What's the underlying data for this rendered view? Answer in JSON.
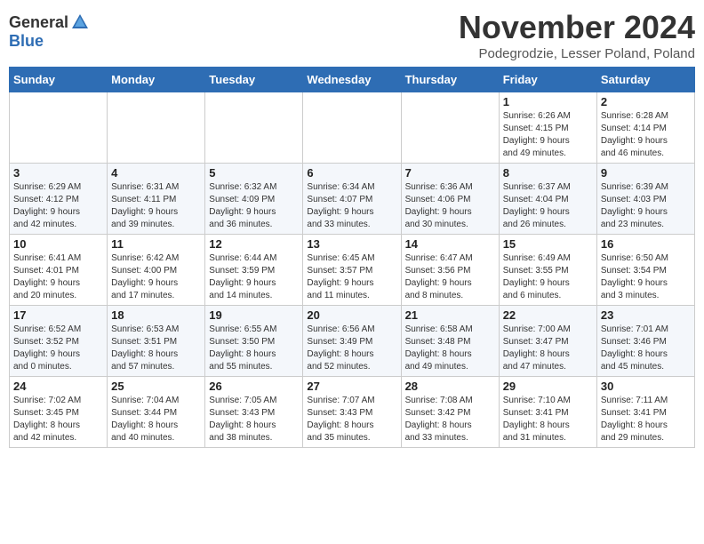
{
  "header": {
    "logo_general": "General",
    "logo_blue": "Blue",
    "month_title": "November 2024",
    "location": "Podegrodzie, Lesser Poland, Poland"
  },
  "days_of_week": [
    "Sunday",
    "Monday",
    "Tuesday",
    "Wednesday",
    "Thursday",
    "Friday",
    "Saturday"
  ],
  "weeks": [
    {
      "days": [
        {
          "num": "",
          "info": ""
        },
        {
          "num": "",
          "info": ""
        },
        {
          "num": "",
          "info": ""
        },
        {
          "num": "",
          "info": ""
        },
        {
          "num": "",
          "info": ""
        },
        {
          "num": "1",
          "info": "Sunrise: 6:26 AM\nSunset: 4:15 PM\nDaylight: 9 hours\nand 49 minutes."
        },
        {
          "num": "2",
          "info": "Sunrise: 6:28 AM\nSunset: 4:14 PM\nDaylight: 9 hours\nand 46 minutes."
        }
      ]
    },
    {
      "days": [
        {
          "num": "3",
          "info": "Sunrise: 6:29 AM\nSunset: 4:12 PM\nDaylight: 9 hours\nand 42 minutes."
        },
        {
          "num": "4",
          "info": "Sunrise: 6:31 AM\nSunset: 4:11 PM\nDaylight: 9 hours\nand 39 minutes."
        },
        {
          "num": "5",
          "info": "Sunrise: 6:32 AM\nSunset: 4:09 PM\nDaylight: 9 hours\nand 36 minutes."
        },
        {
          "num": "6",
          "info": "Sunrise: 6:34 AM\nSunset: 4:07 PM\nDaylight: 9 hours\nand 33 minutes."
        },
        {
          "num": "7",
          "info": "Sunrise: 6:36 AM\nSunset: 4:06 PM\nDaylight: 9 hours\nand 30 minutes."
        },
        {
          "num": "8",
          "info": "Sunrise: 6:37 AM\nSunset: 4:04 PM\nDaylight: 9 hours\nand 26 minutes."
        },
        {
          "num": "9",
          "info": "Sunrise: 6:39 AM\nSunset: 4:03 PM\nDaylight: 9 hours\nand 23 minutes."
        }
      ]
    },
    {
      "days": [
        {
          "num": "10",
          "info": "Sunrise: 6:41 AM\nSunset: 4:01 PM\nDaylight: 9 hours\nand 20 minutes."
        },
        {
          "num": "11",
          "info": "Sunrise: 6:42 AM\nSunset: 4:00 PM\nDaylight: 9 hours\nand 17 minutes."
        },
        {
          "num": "12",
          "info": "Sunrise: 6:44 AM\nSunset: 3:59 PM\nDaylight: 9 hours\nand 14 minutes."
        },
        {
          "num": "13",
          "info": "Sunrise: 6:45 AM\nSunset: 3:57 PM\nDaylight: 9 hours\nand 11 minutes."
        },
        {
          "num": "14",
          "info": "Sunrise: 6:47 AM\nSunset: 3:56 PM\nDaylight: 9 hours\nand 8 minutes."
        },
        {
          "num": "15",
          "info": "Sunrise: 6:49 AM\nSunset: 3:55 PM\nDaylight: 9 hours\nand 6 minutes."
        },
        {
          "num": "16",
          "info": "Sunrise: 6:50 AM\nSunset: 3:54 PM\nDaylight: 9 hours\nand 3 minutes."
        }
      ]
    },
    {
      "days": [
        {
          "num": "17",
          "info": "Sunrise: 6:52 AM\nSunset: 3:52 PM\nDaylight: 9 hours\nand 0 minutes."
        },
        {
          "num": "18",
          "info": "Sunrise: 6:53 AM\nSunset: 3:51 PM\nDaylight: 8 hours\nand 57 minutes."
        },
        {
          "num": "19",
          "info": "Sunrise: 6:55 AM\nSunset: 3:50 PM\nDaylight: 8 hours\nand 55 minutes."
        },
        {
          "num": "20",
          "info": "Sunrise: 6:56 AM\nSunset: 3:49 PM\nDaylight: 8 hours\nand 52 minutes."
        },
        {
          "num": "21",
          "info": "Sunrise: 6:58 AM\nSunset: 3:48 PM\nDaylight: 8 hours\nand 49 minutes."
        },
        {
          "num": "22",
          "info": "Sunrise: 7:00 AM\nSunset: 3:47 PM\nDaylight: 8 hours\nand 47 minutes."
        },
        {
          "num": "23",
          "info": "Sunrise: 7:01 AM\nSunset: 3:46 PM\nDaylight: 8 hours\nand 45 minutes."
        }
      ]
    },
    {
      "days": [
        {
          "num": "24",
          "info": "Sunrise: 7:02 AM\nSunset: 3:45 PM\nDaylight: 8 hours\nand 42 minutes."
        },
        {
          "num": "25",
          "info": "Sunrise: 7:04 AM\nSunset: 3:44 PM\nDaylight: 8 hours\nand 40 minutes."
        },
        {
          "num": "26",
          "info": "Sunrise: 7:05 AM\nSunset: 3:43 PM\nDaylight: 8 hours\nand 38 minutes."
        },
        {
          "num": "27",
          "info": "Sunrise: 7:07 AM\nSunset: 3:43 PM\nDaylight: 8 hours\nand 35 minutes."
        },
        {
          "num": "28",
          "info": "Sunrise: 7:08 AM\nSunset: 3:42 PM\nDaylight: 8 hours\nand 33 minutes."
        },
        {
          "num": "29",
          "info": "Sunrise: 7:10 AM\nSunset: 3:41 PM\nDaylight: 8 hours\nand 31 minutes."
        },
        {
          "num": "30",
          "info": "Sunrise: 7:11 AM\nSunset: 3:41 PM\nDaylight: 8 hours\nand 29 minutes."
        }
      ]
    }
  ]
}
